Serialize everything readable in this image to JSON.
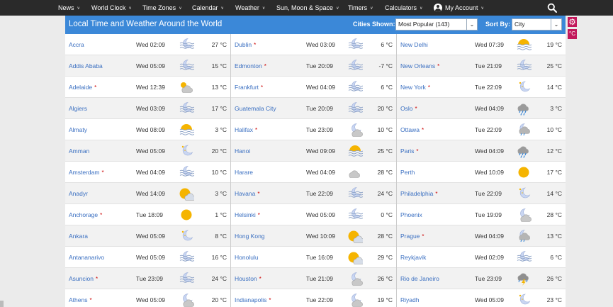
{
  "nav": {
    "items": [
      {
        "label": "News",
        "name": "nav-news"
      },
      {
        "label": "World Clock",
        "name": "nav-world-clock"
      },
      {
        "label": "Time Zones",
        "name": "nav-time-zones"
      },
      {
        "label": "Calendar",
        "name": "nav-calendar"
      },
      {
        "label": "Weather",
        "name": "nav-weather"
      },
      {
        "label": "Sun, Moon & Space",
        "name": "nav-sun-moon-space"
      },
      {
        "label": "Timers",
        "name": "nav-timers"
      },
      {
        "label": "Calculators",
        "name": "nav-calculators"
      },
      {
        "label": "My Account",
        "name": "nav-my-account"
      }
    ]
  },
  "header": {
    "title": "Local Time and Weather Around the World",
    "cities_label": "Cities Shown:",
    "cities_value": "Most Popular (143)",
    "sort_label": "Sort By:",
    "sort_value": "City",
    "unit_button": "°C"
  },
  "columns": [
    [
      {
        "city": "Accra",
        "dst": false,
        "time": "Wed 02:09",
        "icon": "fog-moon",
        "temp": "27 °C"
      },
      {
        "city": "Addis Ababa",
        "dst": false,
        "time": "Wed 05:09",
        "icon": "fog-moon",
        "temp": "15 °C"
      },
      {
        "city": "Adelaide",
        "dst": true,
        "time": "Wed 12:39",
        "icon": "cloud-sun",
        "temp": "13 °C"
      },
      {
        "city": "Algiers",
        "dst": false,
        "time": "Wed 03:09",
        "icon": "fog-moon",
        "temp": "17 °C"
      },
      {
        "city": "Almaty",
        "dst": false,
        "time": "Wed 08:09",
        "icon": "fog-sun",
        "temp": "3 °C"
      },
      {
        "city": "Amman",
        "dst": false,
        "time": "Wed 05:09",
        "icon": "moon-stars",
        "temp": "20 °C"
      },
      {
        "city": "Amsterdam",
        "dst": true,
        "time": "Wed 04:09",
        "icon": "fog-moon",
        "temp": "10 °C"
      },
      {
        "city": "Anadyr",
        "dst": false,
        "time": "Wed 14:09",
        "icon": "sun-cloud",
        "temp": "3 °C"
      },
      {
        "city": "Anchorage",
        "dst": true,
        "time": "Tue 18:09",
        "icon": "sun",
        "temp": "1 °C"
      },
      {
        "city": "Ankara",
        "dst": false,
        "time": "Wed 05:09",
        "icon": "moon-stars",
        "temp": "8 °C"
      },
      {
        "city": "Antananarivo",
        "dst": false,
        "time": "Wed 05:09",
        "icon": "fog-moon",
        "temp": "16 °C"
      },
      {
        "city": "Asuncion",
        "dst": true,
        "time": "Tue 23:09",
        "icon": "fog-moon",
        "temp": "24 °C"
      },
      {
        "city": "Athens",
        "dst": true,
        "time": "Wed 05:09",
        "icon": "moon-cloud",
        "temp": "20 °C"
      }
    ],
    [
      {
        "city": "Dublin",
        "dst": true,
        "time": "Wed 03:09",
        "icon": "fog-moon",
        "temp": "6 °C"
      },
      {
        "city": "Edmonton",
        "dst": true,
        "time": "Tue 20:09",
        "icon": "fog-moon",
        "temp": "-7 °C"
      },
      {
        "city": "Frankfurt",
        "dst": true,
        "time": "Wed 04:09",
        "icon": "fog-moon",
        "temp": "6 °C"
      },
      {
        "city": "Guatemala City",
        "dst": false,
        "time": "Tue 20:09",
        "icon": "fog-moon",
        "temp": "20 °C"
      },
      {
        "city": "Halifax",
        "dst": true,
        "time": "Tue 23:09",
        "icon": "moon-cloud",
        "temp": "10 °C"
      },
      {
        "city": "Hanoi",
        "dst": false,
        "time": "Wed 09:09",
        "icon": "fog-sun",
        "temp": "25 °C"
      },
      {
        "city": "Harare",
        "dst": false,
        "time": "Wed 04:09",
        "icon": "cloud",
        "temp": "28 °C"
      },
      {
        "city": "Havana",
        "dst": true,
        "time": "Tue 22:09",
        "icon": "fog-moon",
        "temp": "24 °C"
      },
      {
        "city": "Helsinki",
        "dst": true,
        "time": "Wed 05:09",
        "icon": "fog-moon",
        "temp": "0 °C"
      },
      {
        "city": "Hong Kong",
        "dst": false,
        "time": "Wed 10:09",
        "icon": "sun-cloud",
        "temp": "28 °C"
      },
      {
        "city": "Honolulu",
        "dst": false,
        "time": "Tue 16:09",
        "icon": "sun-cloud",
        "temp": "29 °C"
      },
      {
        "city": "Houston",
        "dst": true,
        "time": "Tue 21:09",
        "icon": "moon-cloud",
        "temp": "26 °C"
      },
      {
        "city": "Indianapolis",
        "dst": true,
        "time": "Tue 22:09",
        "icon": "moon-cloud",
        "temp": "19 °C"
      }
    ],
    [
      {
        "city": "New Delhi",
        "dst": false,
        "time": "Wed 07:39",
        "icon": "fog-sun",
        "temp": "19 °C"
      },
      {
        "city": "New Orleans",
        "dst": true,
        "time": "Tue 21:09",
        "icon": "fog-moon",
        "temp": "25 °C"
      },
      {
        "city": "New York",
        "dst": true,
        "time": "Tue 22:09",
        "icon": "moon-stars",
        "temp": "14 °C"
      },
      {
        "city": "Oslo",
        "dst": true,
        "time": "Wed 04:09",
        "icon": "rain-cloud",
        "temp": "3 °C"
      },
      {
        "city": "Ottawa",
        "dst": true,
        "time": "Tue 22:09",
        "icon": "moon-rain",
        "temp": "10 °C"
      },
      {
        "city": "Paris",
        "dst": true,
        "time": "Wed 04:09",
        "icon": "rain-cloud",
        "temp": "12 °C"
      },
      {
        "city": "Perth",
        "dst": false,
        "time": "Wed 10:09",
        "icon": "sun",
        "temp": "17 °C"
      },
      {
        "city": "Philadelphia",
        "dst": true,
        "time": "Tue 22:09",
        "icon": "moon-stars",
        "temp": "14 °C"
      },
      {
        "city": "Phoenix",
        "dst": false,
        "time": "Tue 19:09",
        "icon": "moon-cloud",
        "temp": "28 °C"
      },
      {
        "city": "Prague",
        "dst": true,
        "time": "Wed 04:09",
        "icon": "moon-rain",
        "temp": "13 °C"
      },
      {
        "city": "Reykjavik",
        "dst": false,
        "time": "Wed 02:09",
        "icon": "fog-moon",
        "temp": "6 °C"
      },
      {
        "city": "Rio de Janeiro",
        "dst": false,
        "time": "Tue 23:09",
        "icon": "thunder-cloud",
        "temp": "26 °C"
      },
      {
        "city": "Riyadh",
        "dst": false,
        "time": "Wed 05:09",
        "icon": "moon-stars",
        "temp": "23 °C"
      }
    ]
  ]
}
